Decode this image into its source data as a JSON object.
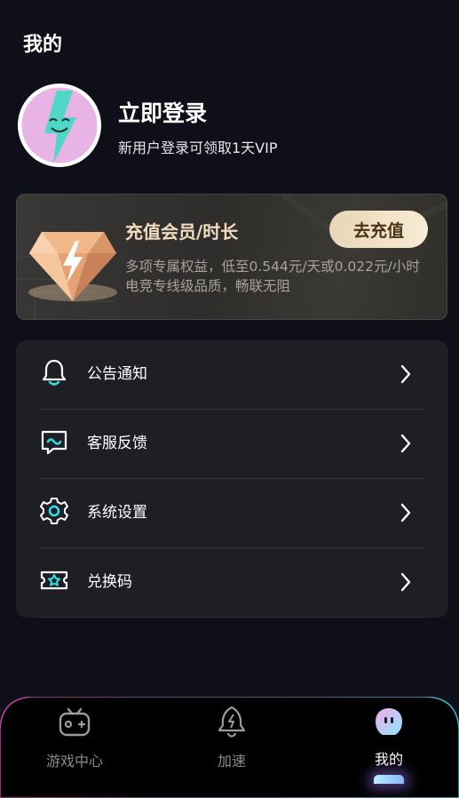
{
  "header": {
    "title": "我的"
  },
  "profile": {
    "login_title": "立即登录",
    "login_subtitle": "新用户登录可领取1天VIP"
  },
  "vip_card": {
    "title": "充值会员/时长",
    "description": "多项专属权益，低至0.544元/天或0.022元/小时电竞专线级品质，畅联无阻",
    "button_label": "去充值"
  },
  "menu": {
    "items": [
      {
        "label": "公告通知",
        "icon": "bell-icon"
      },
      {
        "label": "客服反馈",
        "icon": "chat-icon"
      },
      {
        "label": "系统设置",
        "icon": "gear-icon"
      },
      {
        "label": "兑换码",
        "icon": "ticket-icon"
      }
    ]
  },
  "tabbar": {
    "tabs": [
      {
        "label": "游戏中心",
        "icon": "gamepad-icon"
      },
      {
        "label": "加速",
        "icon": "rocket-icon"
      },
      {
        "label": "我的",
        "icon": "mascot-icon"
      }
    ],
    "active_tab": "我的"
  },
  "colors": {
    "background": "#0f0f19",
    "accent_cyan": "#2fe0e8",
    "gold_text": "#f2dcc0",
    "card_bg": "#1d1f24"
  }
}
